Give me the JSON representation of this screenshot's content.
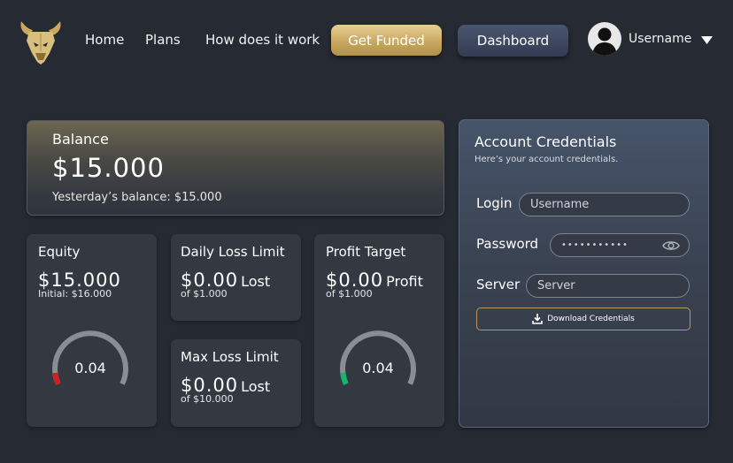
{
  "nav": {
    "links": [
      "Home",
      "Plans",
      "How does it work"
    ],
    "get_funded": "Get Funded",
    "dashboard": "Dashboard",
    "username": "Username"
  },
  "balance": {
    "title": "Balance",
    "amount": "$15.000",
    "yesterday": "Yesterday’s balance: $15.000"
  },
  "equity": {
    "title": "Equity",
    "value": "$15.000",
    "initial": "Initial: $16.000",
    "gauge_value": "0.04",
    "gauge_color": "#d0201e"
  },
  "daily_loss": {
    "title": "Daily Loss Limit",
    "value": "$0.00",
    "suffix": "Lost",
    "of": "of $1.000"
  },
  "max_loss": {
    "title": "Max Loss Limit",
    "value": "$0.00",
    "suffix": "Lost",
    "of": "of $10.000"
  },
  "profit_target": {
    "title": "Profit Target",
    "value": "$0.00",
    "suffix": "Profit",
    "of": "of $1.000",
    "gauge_value": "0.04",
    "gauge_color": "#12b66d"
  },
  "credentials": {
    "title": "Account Credentials",
    "subtitle": "Here’s your account credentials.",
    "login_label": "Login",
    "login_placeholder": "Username",
    "password_label": "Password",
    "password_value": "•••••••••••",
    "server_label": "Server",
    "server_placeholder": "Server",
    "download": "Download Credentials"
  },
  "colors": {
    "background": "#262b33",
    "card": "#333841",
    "gold": "#c9a860",
    "accent_blue": "#3b455c"
  }
}
